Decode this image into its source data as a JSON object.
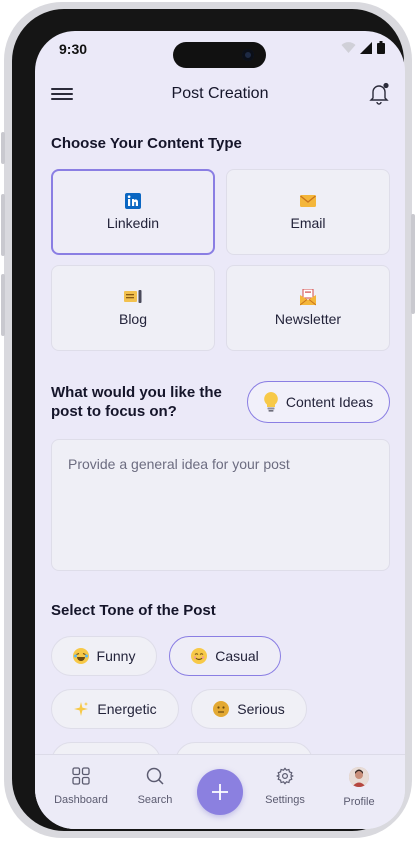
{
  "status": {
    "time": "9:30"
  },
  "header": {
    "title": "Post Creation"
  },
  "content_type": {
    "heading": "Choose Your Content Type",
    "options": [
      {
        "label": "Linkedin",
        "icon": "linkedin-icon",
        "selected": true
      },
      {
        "label": "Email",
        "icon": "envelope-icon",
        "selected": false
      },
      {
        "label": "Blog",
        "icon": "blog-icon",
        "selected": false
      },
      {
        "label": "Newsletter",
        "icon": "newsletter-icon",
        "selected": false
      }
    ]
  },
  "focus": {
    "question": "What would you like the post to focus on?",
    "ideas_button": "Content Ideas",
    "idea_placeholder": "Provide a general idea for your post"
  },
  "tone": {
    "heading": "Select Tone of the Post",
    "chips": [
      {
        "label": "Funny",
        "icon": "laughing-emoji-icon",
        "selected": false
      },
      {
        "label": "Casual",
        "icon": "smiling-emoji-icon",
        "selected": true
      },
      {
        "label": "Energetic",
        "icon": "sparkles-icon",
        "selected": false
      },
      {
        "label": "Serious",
        "icon": "neutral-emoji-icon",
        "selected": false
      }
    ]
  },
  "tabbar": {
    "items": [
      {
        "label": "Dashboard",
        "icon": "grid-icon"
      },
      {
        "label": "Search",
        "icon": "search-icon"
      },
      {
        "label": "",
        "icon": "plus-icon"
      },
      {
        "label": "Settings",
        "icon": "gear-icon"
      },
      {
        "label": "Profile",
        "icon": "avatar-icon"
      }
    ]
  },
  "colors": {
    "accent": "#8b80e0",
    "background": "#ebe9f8",
    "card": "#efeff6"
  }
}
